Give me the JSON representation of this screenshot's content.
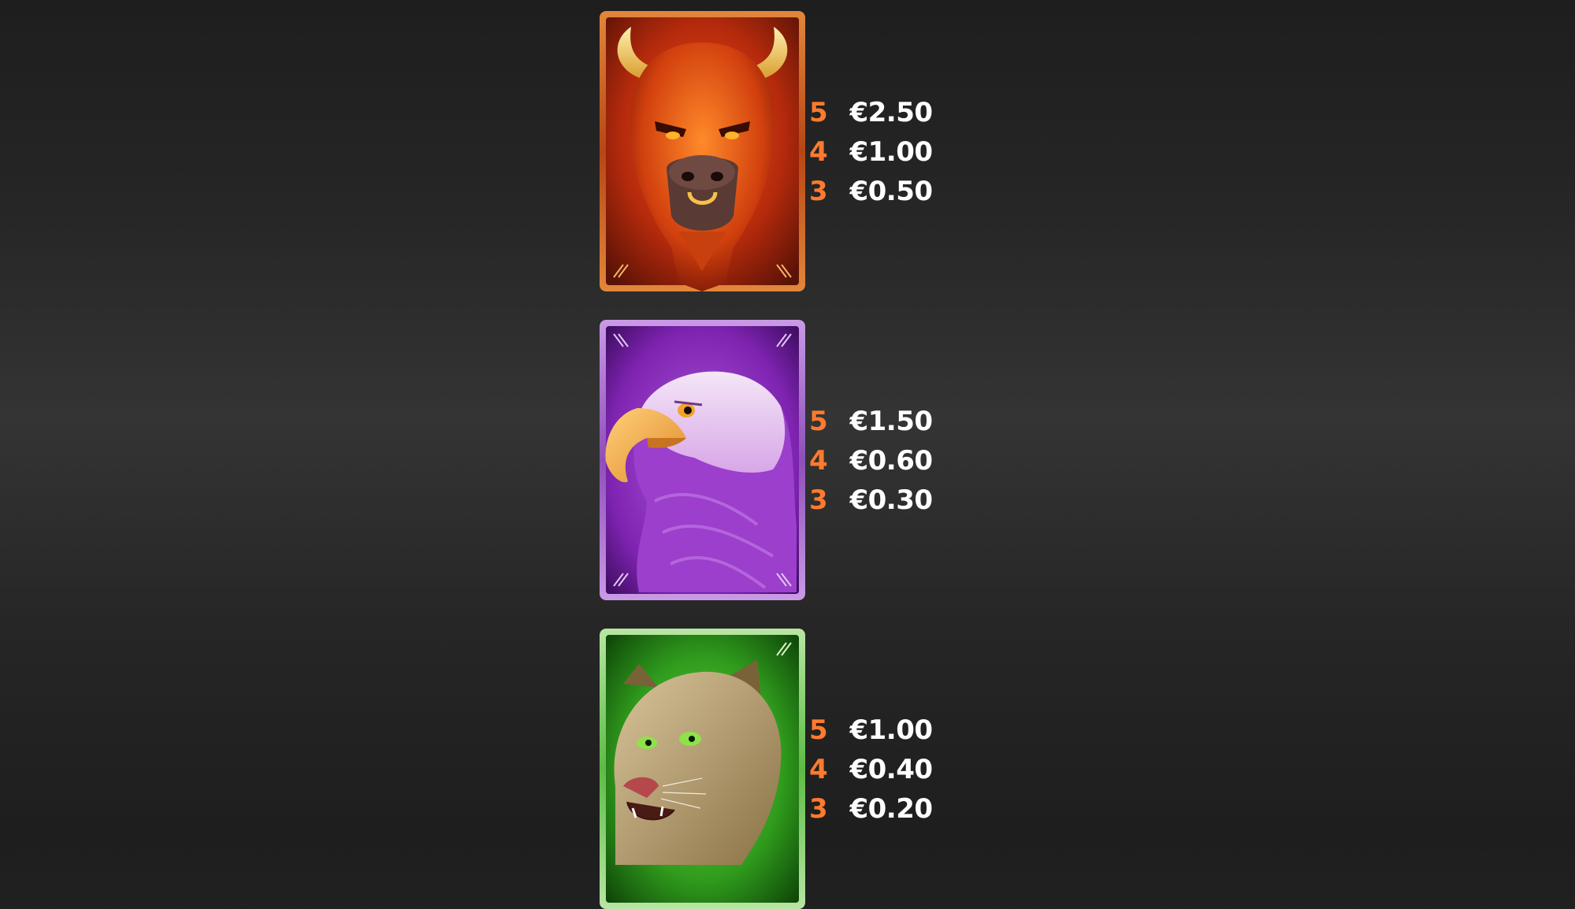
{
  "colors": {
    "count": "#ff7a2e",
    "value": "#ffffff",
    "bison_frame": "#c9581c",
    "eagle_frame": "#8e4fb8",
    "cougar_frame": "#5dbb45"
  },
  "symbols": [
    {
      "icon": "bison-icon",
      "payouts": [
        {
          "count": "5",
          "value": "€2.50"
        },
        {
          "count": "4",
          "value": "€1.00"
        },
        {
          "count": "3",
          "value": "€0.50"
        }
      ]
    },
    {
      "icon": "eagle-icon",
      "payouts": [
        {
          "count": "5",
          "value": "€1.50"
        },
        {
          "count": "4",
          "value": "€0.60"
        },
        {
          "count": "3",
          "value": "€0.30"
        }
      ]
    },
    {
      "icon": "cougar-icon",
      "payouts": [
        {
          "count": "5",
          "value": "€1.00"
        },
        {
          "count": "4",
          "value": "€0.40"
        },
        {
          "count": "3",
          "value": "€0.20"
        }
      ]
    }
  ]
}
